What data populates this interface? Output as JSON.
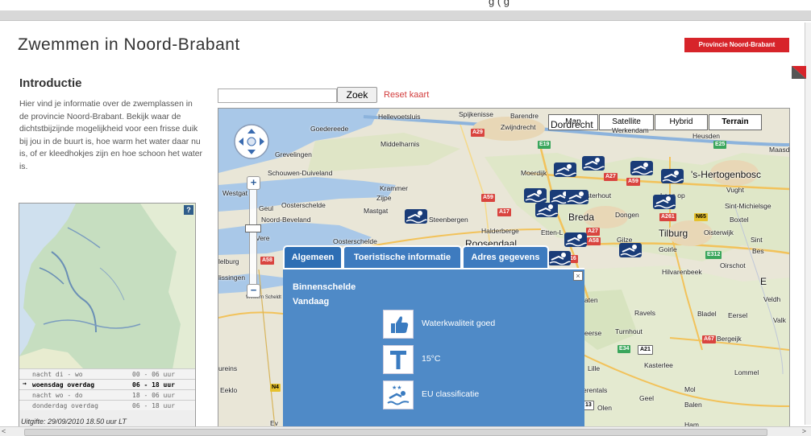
{
  "top_clip_text": "g                                          (  g",
  "header": {
    "title": "Zwemmen in Noord-Brabant",
    "brand": "Provincie Noord-Brabant"
  },
  "intro": {
    "title": "Introductie",
    "text": "Hier vind je informatie over de zwemplassen in de provincie Noord-Brabant. Bekijk waar de dichtstbijzijnde mogelijkheid voor een frisse duik bij jou in de buurt is, hoe warm het water daar nu is, of er kleedhokjes zijn en hoe schoon het water is."
  },
  "weather": {
    "help": "?",
    "rows": [
      {
        "label": "nacht di - wo",
        "time": "00 - 06 uur"
      },
      {
        "label": "woensdag overdag",
        "time": "06 - 18 uur",
        "selected": true
      },
      {
        "label": "nacht wo - do",
        "time": "18 - 06 uur"
      },
      {
        "label": "donderdag overdag",
        "time": "06 - 18 uur"
      }
    ],
    "issued": "Uitgifte: 29/09/2010 18.50 uur LT"
  },
  "search": {
    "value": "",
    "button": "Zoek",
    "reset": "Reset kaart"
  },
  "map": {
    "types": [
      "Map",
      "Satellite",
      "Hybrid",
      "Terrain"
    ],
    "active_type": "Terrain",
    "places": {
      "hellevoetsluis": "Hellevoetsluis",
      "spijkenisse": "Spijkenisse",
      "barendrecht": "Barendre",
      "zwijndrecht": "Zwijndrecht",
      "dordrecht": "Dordrecht",
      "werkendam": "Werkendam",
      "goedereede": "Goedereede",
      "middelharnis": "Middelharnis",
      "grevelingen": "Grevelingen",
      "heusden": "Heusden",
      "maas": "Maasd",
      "schouwen": "Schouwen-Duiveland",
      "moerdijk": "Moerdijk",
      "krammer": "Krammer",
      "hertogenbosch": "'s-Hertogenbosc",
      "vught": "Vught",
      "westgat": "Westgat",
      "oosterschelde": "Oosterschelde",
      "zijpe": "Zijpe",
      "oosterhout": "Oosterhout",
      "loon": "Loon op",
      "geul": "Geul",
      "mastgat": "Mastgat",
      "sintmichiels": "Sint-Michielsge",
      "noordbeveland": "Noord-Beveland",
      "steenbergen": "Steenbergen",
      "breda": "Breda",
      "dongen": "Dongen",
      "boxtel": "Boxtel",
      "halderberge": "Halderberge",
      "etten": "Etten-L",
      "tilburg": "Tilburg",
      "oisterwijk": "Oisterwijk",
      "osterschelde2": "Oosterschelde",
      "roosendaal": "Roosendaal",
      "gilze": "Gilze",
      "goirle": "Goirle",
      "sint": "Sint",
      "bes": "Bes",
      "vere": "Vere",
      "oirschot": "Oirschot",
      "elburg": "lelburg",
      "vlissingen": "lissingen",
      "hilvarenbeek": "Hilvarenbeek",
      "e": "E",
      "aten": "aten",
      "veldh": "Veldh",
      "ravels": "Ravels",
      "bladel": "Bladel",
      "eersel": "Eersel",
      "valk": "Valk",
      "westernschelde": "Western Scheldt",
      "beerse": "eerse",
      "turnhout": "Turnhout",
      "bergeijk": "Bergeijk",
      "kasterlee": "Kasterlee",
      "lille": "Lille",
      "lommel": "Lommel",
      "eureins": "ureins",
      "eeklo": "Eeklo",
      "herentals": "erentals",
      "mol": "Mol",
      "geel": "Geel",
      "balen": "Balen",
      "olen": "Olen",
      "ev": "Ev",
      "ham": "Ham"
    },
    "shields": {
      "a29": "A29",
      "e19": "E19",
      "e25": "E25",
      "a59a": "A59",
      "a27a": "A27",
      "a59b": "A59",
      "a17": "A17",
      "a261": "A261",
      "n65": "N65",
      "a27b": "A27",
      "a58a": "A58",
      "a58b": "A58",
      "a16": "16",
      "e312": "E312",
      "a67": "A67",
      "e34": "E34",
      "a21": "A21",
      "n4": "N4",
      "a13": "13"
    }
  },
  "popup": {
    "tabs": [
      "Algemeen",
      "Toeristische informatie",
      "Adres gegevens"
    ],
    "active_tab": "Algemeen",
    "close": "×",
    "name": "Binnenschelde",
    "day": "Vandaag",
    "items": [
      {
        "icon": "thumbs-up-icon",
        "label": "Waterkwaliteit goed"
      },
      {
        "icon": "temperature-icon",
        "label": "15°C"
      },
      {
        "icon": "eu-swim-icon",
        "label": "EU classificatie"
      }
    ]
  },
  "scroll": {
    "left": "<",
    "right": ">"
  }
}
